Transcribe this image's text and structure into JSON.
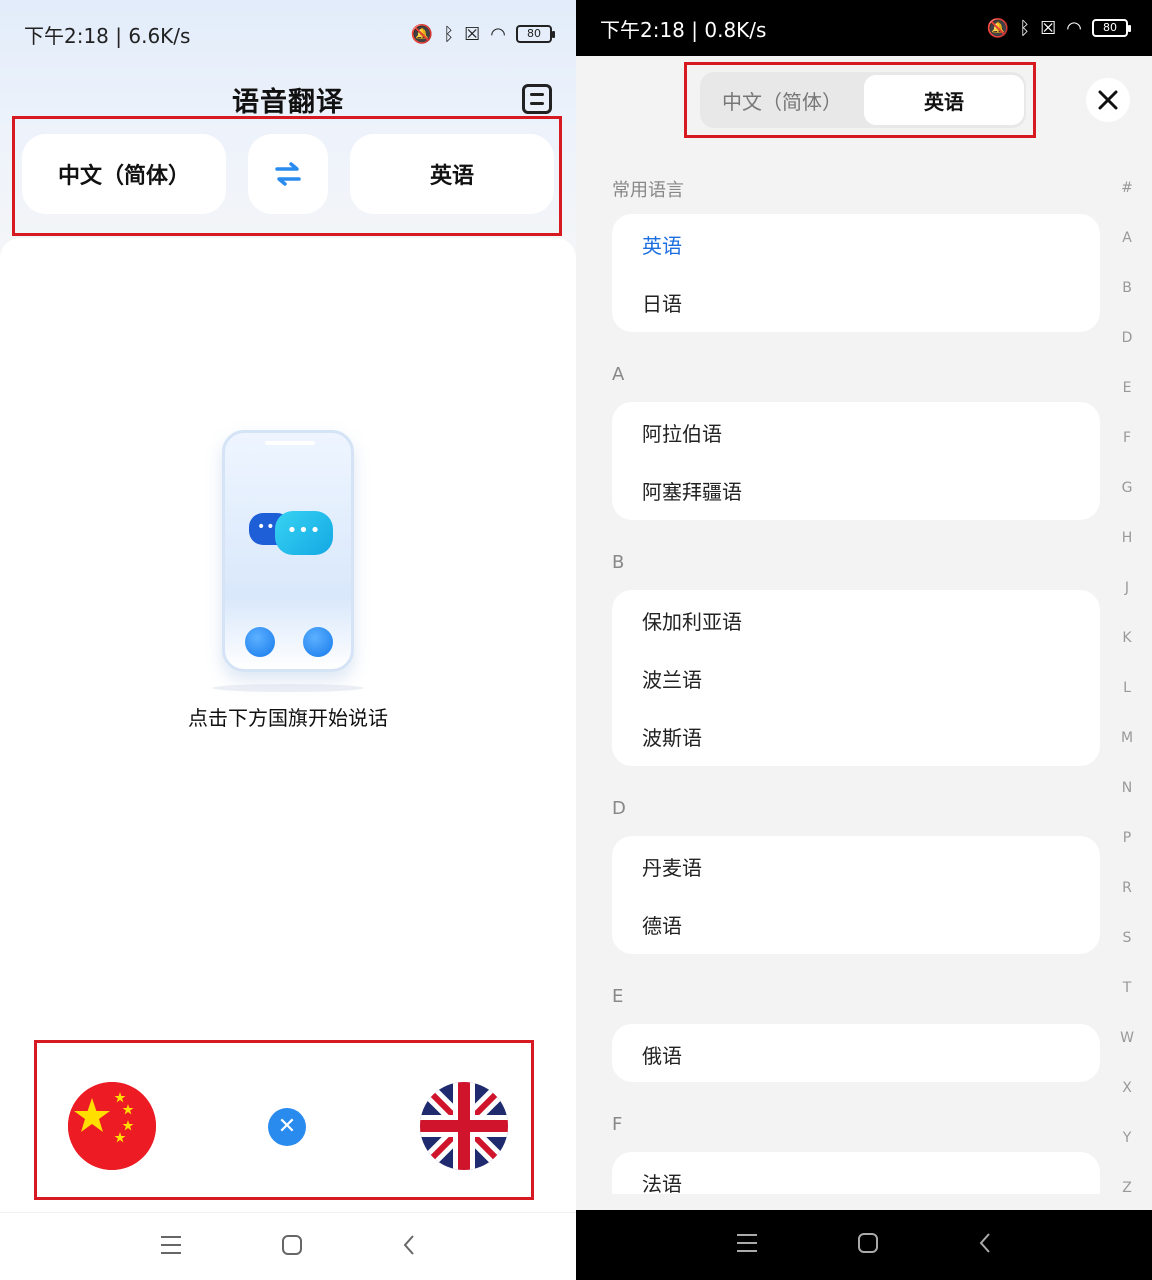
{
  "left": {
    "status": {
      "time": "下午2:18 | 6.6K/s",
      "battery": "80"
    },
    "title": "语音翻译",
    "source_lang": "中文（简体）",
    "target_lang": "英语",
    "hint": "点击下方国旗开始说话",
    "illustration": {
      "bubble_dots": "•••"
    }
  },
  "right": {
    "status": {
      "time": "下午2:18 | 0.8K/s",
      "battery": "80"
    },
    "tabs": [
      "中文（简体）",
      "英语"
    ],
    "active_tab": "英语",
    "sections": [
      {
        "title": "常用语言",
        "items": [
          "英语",
          "日语"
        ],
        "active": "英语"
      },
      {
        "title": "A",
        "items": [
          "阿拉伯语",
          "阿塞拜疆语"
        ]
      },
      {
        "title": "B",
        "items": [
          "保加利亚语",
          "波兰语",
          "波斯语"
        ]
      },
      {
        "title": "D",
        "items": [
          "丹麦语",
          "德语"
        ]
      },
      {
        "title": "E",
        "items": [
          "俄语"
        ]
      },
      {
        "title": "F",
        "items": [
          "法语"
        ]
      }
    ],
    "index": [
      "#",
      "A",
      "B",
      "D",
      "E",
      "F",
      "G",
      "H",
      "J",
      "K",
      "L",
      "M",
      "N",
      "P",
      "R",
      "S",
      "T",
      "W",
      "X",
      "Y",
      "Z"
    ]
  },
  "colors": {
    "accent": "#1d6fe0",
    "highlight": "#d71a21",
    "swap": "#2a8bef"
  },
  "icons": [
    "bluetooth-icon",
    "sim-off-icon",
    "wifi-icon",
    "battery-icon",
    "mute-bell-icon",
    "history-icon",
    "swap-icon",
    "close-icon",
    "menu-icon",
    "home-icon",
    "back-icon"
  ]
}
